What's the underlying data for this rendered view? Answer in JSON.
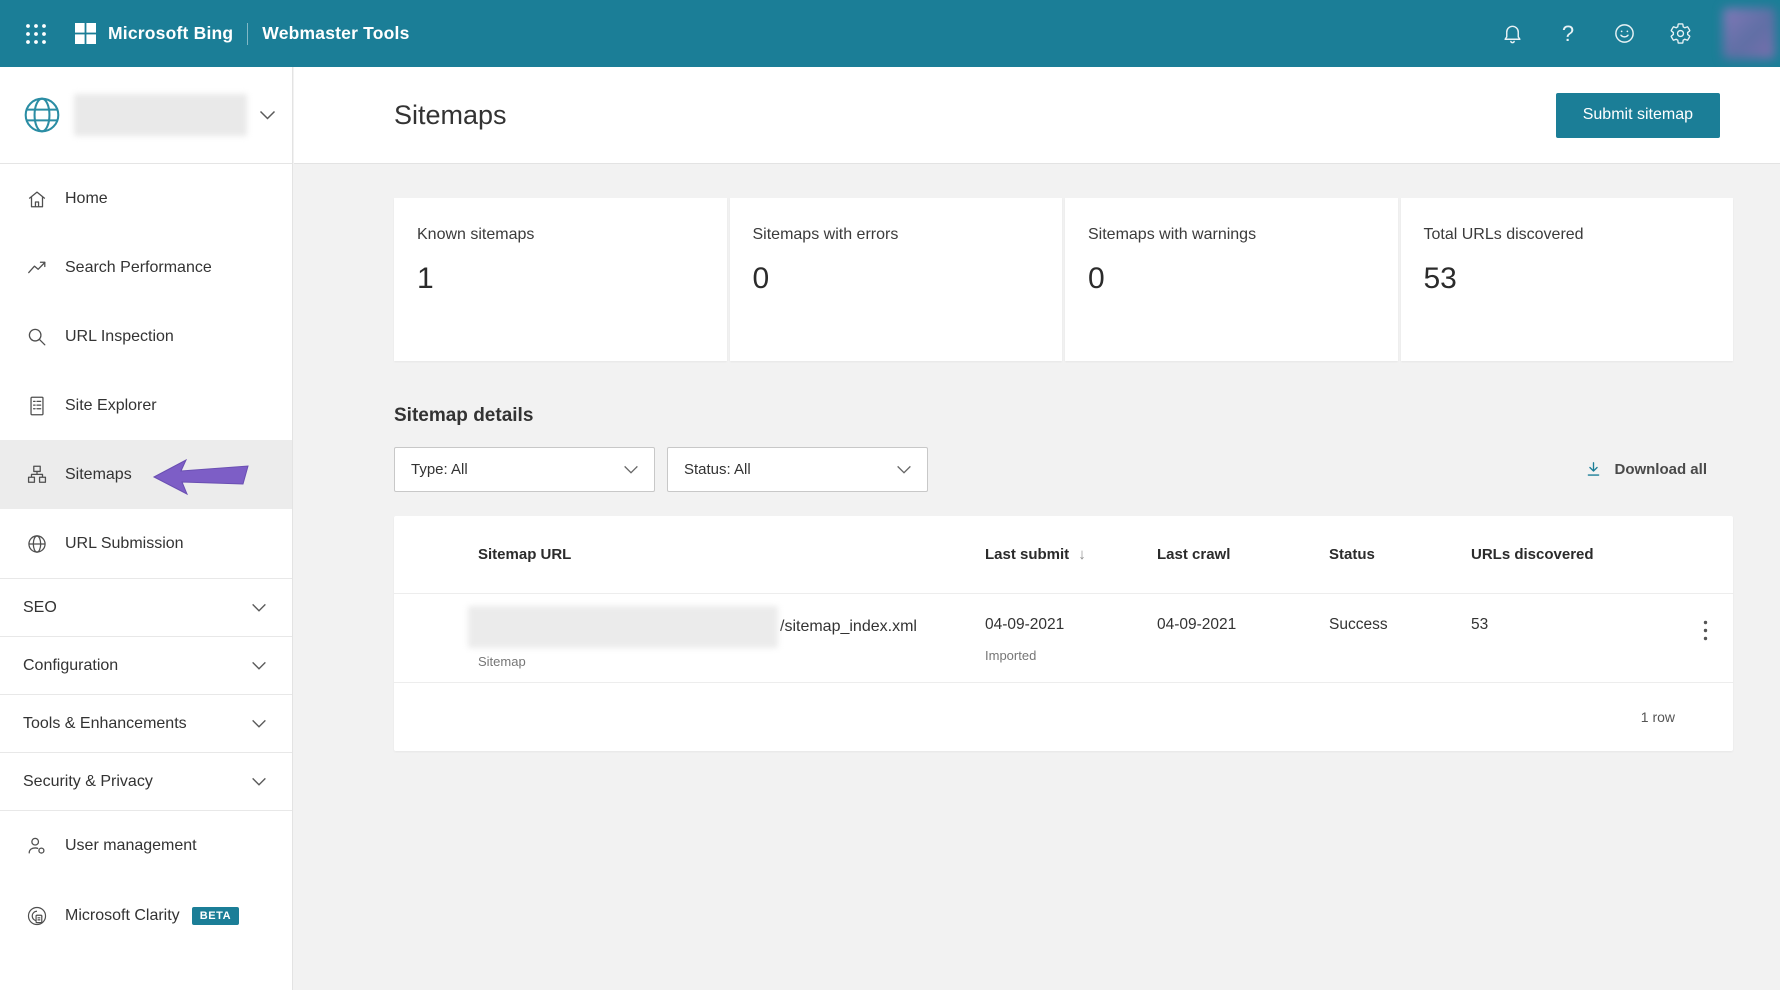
{
  "topbar": {
    "brand": "Microsoft Bing",
    "product": "Webmaster Tools"
  },
  "icons": {
    "help": "?",
    "sort_desc": "↓"
  },
  "sidebar": {
    "nav": [
      {
        "label": "Home"
      },
      {
        "label": "Search Performance"
      },
      {
        "label": "URL Inspection"
      },
      {
        "label": "Site Explorer"
      },
      {
        "label": "Sitemaps"
      },
      {
        "label": "URL Submission"
      }
    ],
    "sections": [
      {
        "label": "SEO"
      },
      {
        "label": "Configuration"
      },
      {
        "label": "Tools & Enhancements"
      },
      {
        "label": "Security & Privacy"
      }
    ],
    "footer_nav": [
      {
        "label": "User management"
      },
      {
        "label": "Microsoft Clarity",
        "badge": "BETA"
      }
    ]
  },
  "header": {
    "title": "Sitemaps",
    "submit_button": "Submit sitemap"
  },
  "stats": [
    {
      "label": "Known sitemaps",
      "value": "1"
    },
    {
      "label": "Sitemaps with errors",
      "value": "0"
    },
    {
      "label": "Sitemaps with warnings",
      "value": "0"
    },
    {
      "label": "Total URLs discovered",
      "value": "53"
    }
  ],
  "filters": {
    "heading": "Sitemap details",
    "type": "Type: All",
    "status": "Status: All",
    "download": "Download all"
  },
  "table": {
    "columns": {
      "url": "Sitemap URL",
      "last_submit": "Last submit",
      "last_crawl": "Last crawl",
      "status": "Status",
      "urls_discovered": "URLs discovered"
    },
    "row": {
      "url": "/sitemap_index.xml",
      "type": "Sitemap",
      "last_submit": "04-09-2021",
      "last_submit_note": "Imported",
      "last_crawl": "04-09-2021",
      "status": "Success",
      "urls_discovered": "53"
    },
    "footer": "1 row"
  },
  "colors": {
    "accent": "#1b7e97",
    "annotation_arrow": "#7d5ec6"
  }
}
